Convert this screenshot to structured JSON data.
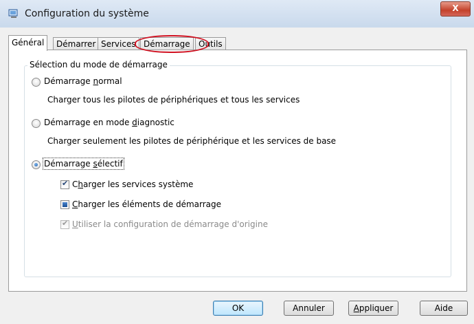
{
  "window": {
    "title": "Configuration du système",
    "close_label": "X"
  },
  "tabs": [
    {
      "label": "Général",
      "active": true
    },
    {
      "label": "Démarrer",
      "active": false
    },
    {
      "label": "Services",
      "active": false
    },
    {
      "label": "Démarrage",
      "active": false
    },
    {
      "label": "Outils",
      "active": false
    }
  ],
  "startup_selection": {
    "legend": "Sélection du mode de démarrage",
    "normal": {
      "pre": "Démarrage ",
      "accel": "n",
      "post": "ormal",
      "description": "Charger tous les pilotes de périphériques et tous les services",
      "selected": false
    },
    "diagnostic": {
      "pre": "Démarrage en mode ",
      "accel": "d",
      "post": "iagnostic",
      "description": "Charger seulement les pilotes de périphérique et les services de base",
      "selected": false
    },
    "selective": {
      "pre": "Démarrage ",
      "accel": "s",
      "post": "électif",
      "selected": true,
      "options": {
        "load_services": {
          "pre": "C",
          "accel": "h",
          "post": "arger les services système",
          "state": "checked"
        },
        "load_startup_items": {
          "pre": "",
          "accel": "C",
          "post": "harger les éléments de démarrage",
          "state": "indeterminate"
        },
        "use_original_config": {
          "pre": "",
          "accel": "U",
          "post": "tiliser la configuration de démarrage d'origine",
          "state": "checked-disabled"
        }
      }
    }
  },
  "buttons": {
    "ok": "OK",
    "cancel": "Annuler",
    "apply_accel": "A",
    "apply_post": "ppliquer",
    "help": "Aide"
  },
  "colors": {
    "highlight_ellipse": "#d01020",
    "close_button": "#c4422b"
  }
}
